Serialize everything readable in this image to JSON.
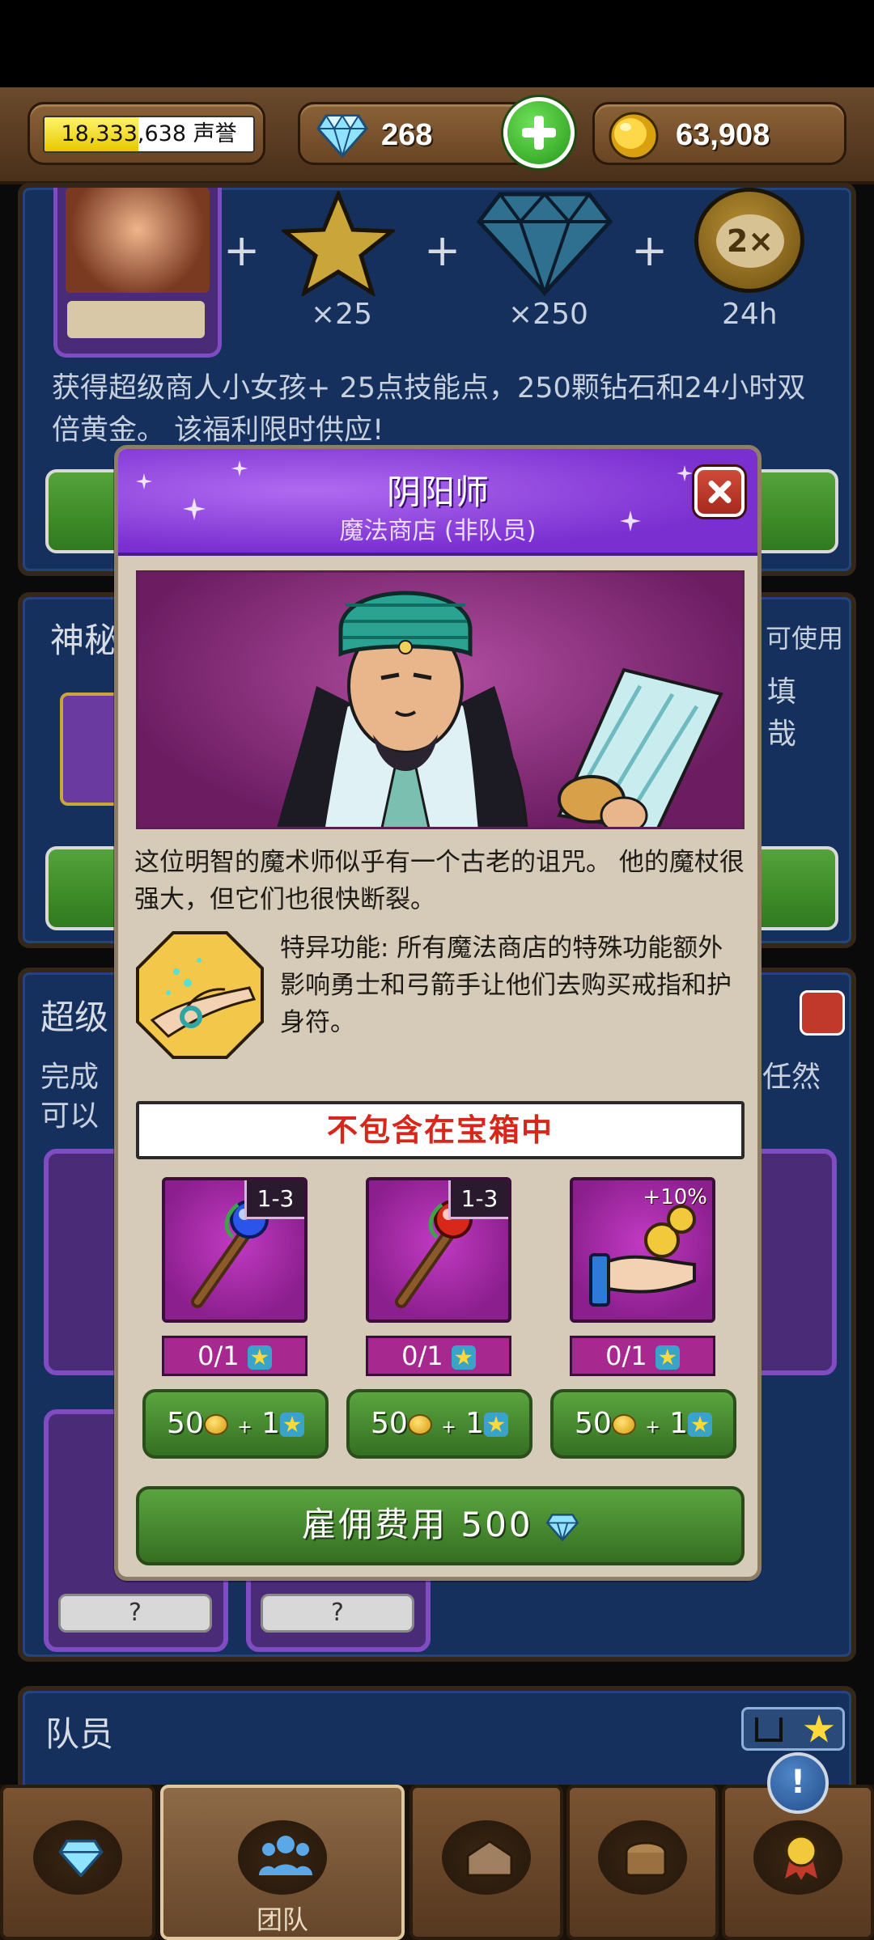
{
  "topbar": {
    "reputation_value": "18,333,638 声誉",
    "reputation_progress": 0.45,
    "gems": "268",
    "gold": "63,908"
  },
  "background": {
    "offer_multipliers": [
      "×25",
      "×250",
      "24h"
    ],
    "offer_badge": "2×",
    "offer_text": "获得超级商人小女孩+ 25点技能点，250颗钻石和24小时双倍黄金。 该福利限时供应!",
    "mystery_title": "神秘",
    "mystery_right": [
      "可使用",
      "填",
      "哉"
    ],
    "super_title": "超级",
    "super_text": "完成",
    "super_text2": "可以",
    "super_right": "任然",
    "slot_unknown": "?",
    "team_title": "队员"
  },
  "modal": {
    "title": "阴阳师",
    "subtitle": "魔法商店 (非队员)",
    "description": "这位明智的魔术师似乎有一个古老的诅咒。 他的魔杖很强大，但它们也很快断裂。",
    "ability": "特异功能: 所有魔法商店的特殊功能额外影响勇士和弓箭手让他们去购买戒指和护身符。",
    "banner": "不包含在宝箱中",
    "items": [
      {
        "tag": "1-3",
        "count": "0/1",
        "cost_gold": "50",
        "cost_plus": "+",
        "cost_star": "1"
      },
      {
        "tag": "1-3",
        "count": "0/1",
        "cost_gold": "50",
        "cost_plus": "+",
        "cost_star": "1"
      },
      {
        "tag": "+10%",
        "count": "0/1",
        "cost_gold": "50",
        "cost_plus": "+",
        "cost_star": "1"
      }
    ],
    "hire_label": "雇佣费用 500"
  },
  "nav": {
    "team_label": "团队"
  },
  "help": "!"
}
